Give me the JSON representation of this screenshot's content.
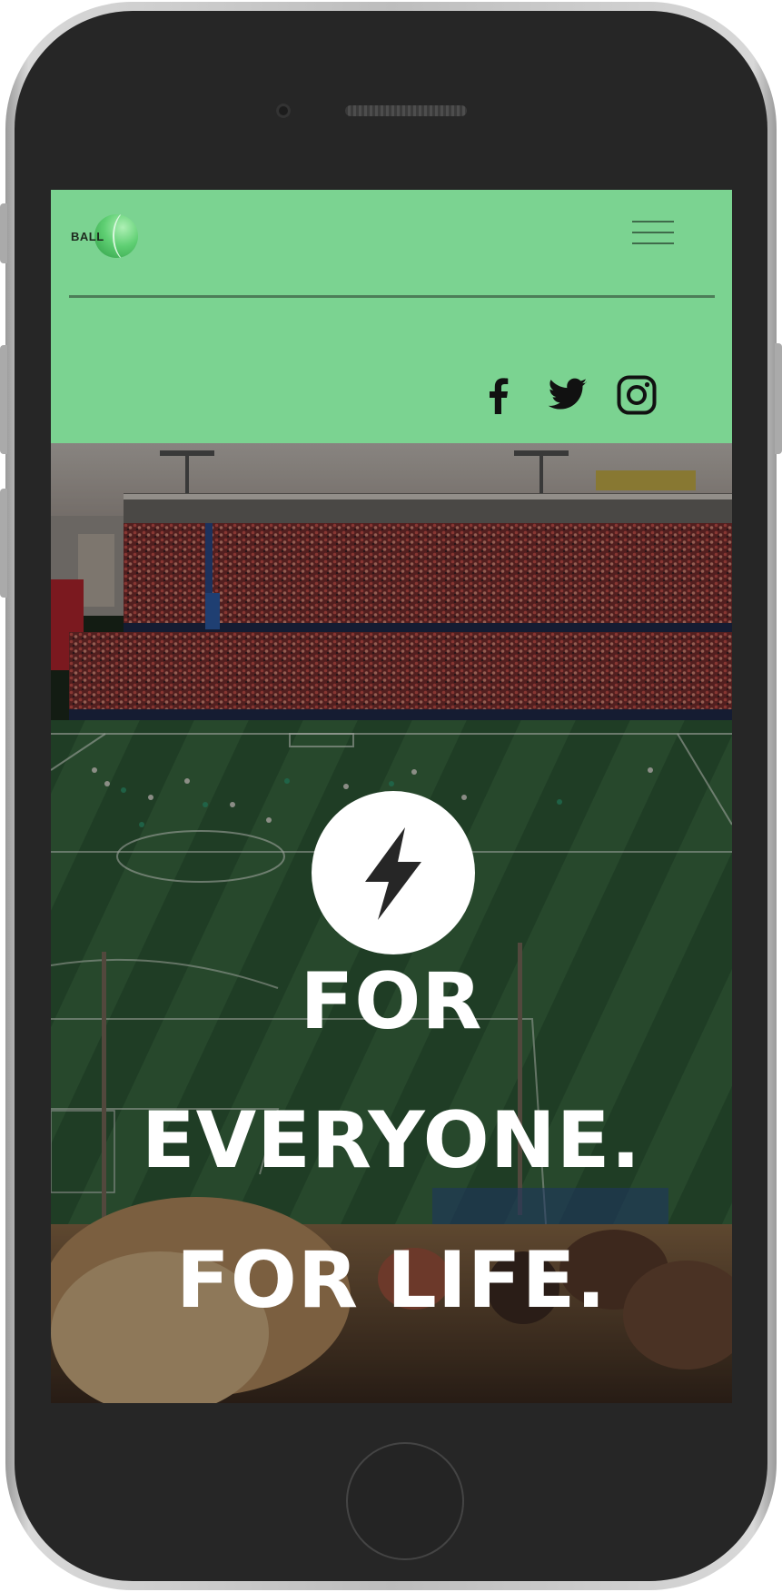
{
  "header": {
    "logo_text": "BALL",
    "colors": {
      "header_background": "#7bd391",
      "divider": "#4d7d58",
      "icon": "#111111"
    },
    "menu_icon": "hamburger-icon",
    "social_icons": [
      "facebook-icon",
      "twitter-icon",
      "instagram-icon"
    ]
  },
  "hero": {
    "background": "stadium-photo",
    "badge_icon": "lightning-bolt-icon",
    "headline_lines": [
      "FOR",
      "EVERYONE.",
      "FOR LIFE."
    ]
  }
}
